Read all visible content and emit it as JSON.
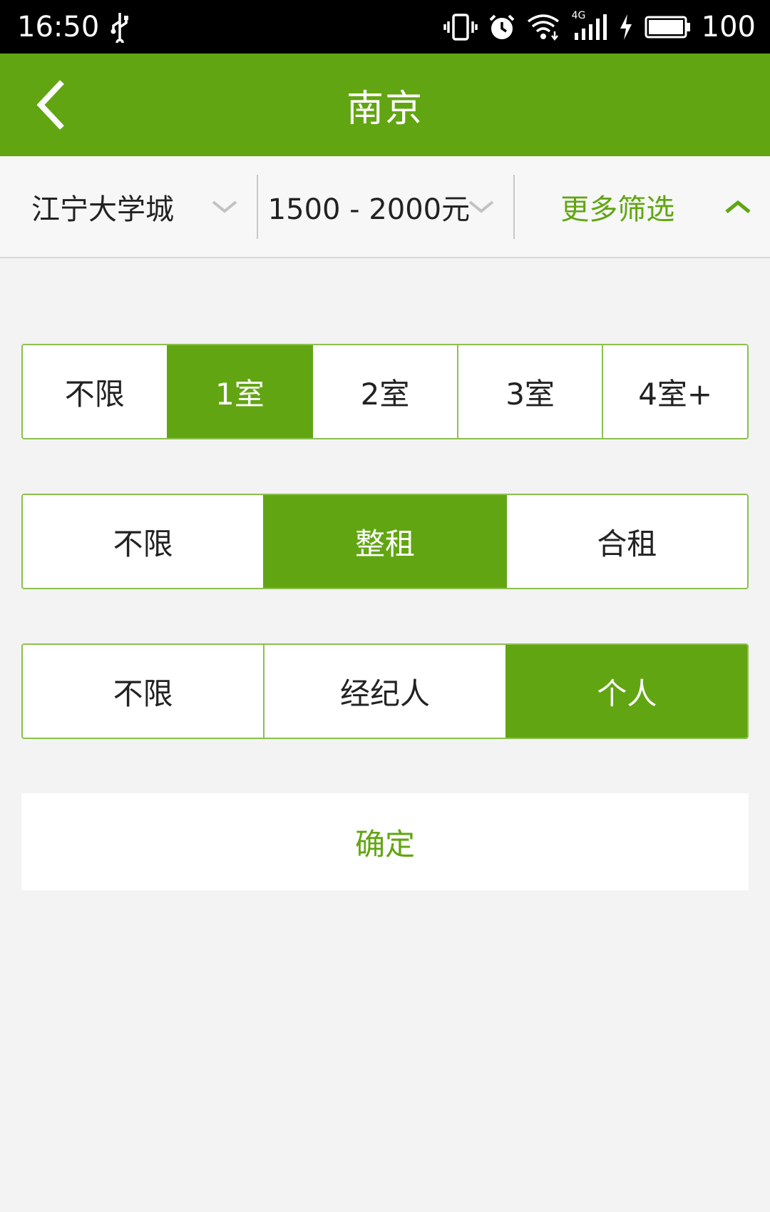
{
  "status_bar": {
    "time": "16:50",
    "battery": "100",
    "network": "4G",
    "icons": [
      "usb-icon",
      "vibrate-icon",
      "alarm-icon",
      "wifi-icon",
      "signal-icon",
      "charging-icon",
      "battery-icon"
    ]
  },
  "header": {
    "title": "南京",
    "back_icon": "chevron-left-icon"
  },
  "filter_bar": {
    "area_label": "江宁大学城",
    "price_label": "1500 - 2000元",
    "more_label": "更多筛选"
  },
  "rooms": {
    "options": [
      "不限",
      "1室",
      "2室",
      "3室",
      "4室+"
    ],
    "selected": "1室"
  },
  "rent_type": {
    "options": [
      "不限",
      "整租",
      "合租"
    ],
    "selected": "整租"
  },
  "source": {
    "options": [
      "不限",
      "经纪人",
      "个人"
    ],
    "selected": "个人"
  },
  "confirm_label": "确定",
  "colors": {
    "brand_green": "#62a512",
    "background": "#f2f3f2",
    "border_green": "#8cc04d"
  }
}
